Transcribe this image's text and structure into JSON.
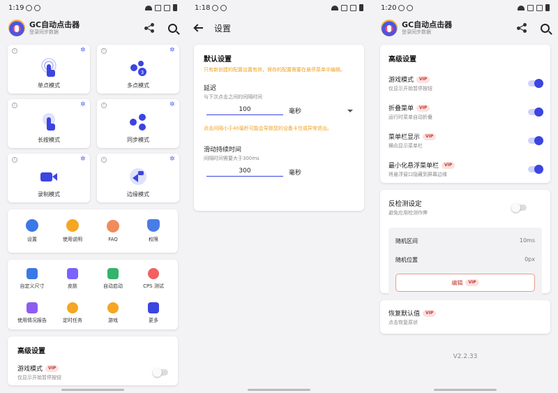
{
  "screen1": {
    "status": {
      "time": "1:19"
    },
    "app": {
      "title": "GC自动点击器",
      "subtitle": "登录同步数据"
    },
    "modes": [
      {
        "label": "单点模式",
        "icon": "single-tap-icon"
      },
      {
        "label": "多点模式",
        "icon": "multi-tap-icon"
      },
      {
        "label": "长按模式",
        "icon": "long-press-icon"
      },
      {
        "label": "同步模式",
        "icon": "sync-icon"
      },
      {
        "label": "录制模式",
        "icon": "record-icon"
      },
      {
        "label": "边缘模式",
        "icon": "edge-icon"
      }
    ],
    "quick": [
      {
        "label": "设置",
        "icon": "gear-icon",
        "color": "#3b78e7"
      },
      {
        "label": "使用说明",
        "icon": "info-icon",
        "color": "#f5a623"
      },
      {
        "label": "FAQ",
        "icon": "question-icon",
        "color": "#f28b5b"
      },
      {
        "label": "权限",
        "icon": "shield-icon",
        "color": "#4a7ce6"
      }
    ],
    "tools": [
      {
        "label": "自定义尺寸",
        "icon": "ruler-icon",
        "color": "#3b78e7"
      },
      {
        "label": "皮肤",
        "icon": "shirt-icon",
        "color": "#7b61ff"
      },
      {
        "label": "自动启动",
        "icon": "phone-icon",
        "color": "#34b36b"
      },
      {
        "label": "CPS 测试",
        "icon": "speedometer-icon",
        "color": "#f26060"
      },
      {
        "label": "使用情况报告",
        "icon": "chart-icon",
        "color": "#8e5cf0"
      },
      {
        "label": "定时任务",
        "icon": "timer-icon",
        "color": "#f5a623"
      },
      {
        "label": "游戏",
        "icon": "game-icon",
        "color": "#f5a623"
      },
      {
        "label": "更多",
        "icon": "grid-icon",
        "color": "#3b45e0"
      }
    ],
    "advanced": {
      "header": "高级设置",
      "game_mode": "游戏模式",
      "vip": "VIP",
      "game_mode_sub": "仅显示开始暂停按钮"
    }
  },
  "screen2": {
    "status": {
      "time": "1:18"
    },
    "title": "设置",
    "default_header": "默认设置",
    "default_note": "只有新创建的配置设置有效，保存的配置需要在悬停菜单中编辑。",
    "delay_label": "延迟",
    "delay_sub": "与下次点击之间的间隔时间",
    "delay_value": "100",
    "delay_unit": "毫秒",
    "delay_warning": "点击间隔小于40毫秒可能会导致您的设备卡住或异常退出。",
    "swipe_label": "滑动持续时间",
    "swipe_sub": "间隔时间需要大于300ms",
    "swipe_value": "300",
    "swipe_unit": "毫秒"
  },
  "screen3": {
    "status": {
      "time": "1:20"
    },
    "app": {
      "title": "GC自动点击器",
      "subtitle": "登录同步数据"
    },
    "advanced_header": "高级设置",
    "vip": "VIP",
    "settings": [
      {
        "title": "游戏模式",
        "sub": "仅显示开始暂停按钮",
        "on": true
      },
      {
        "title": "折叠菜单",
        "sub": "运行时菜单自动折叠",
        "on": true
      },
      {
        "title": "菜单栏显示",
        "sub": "横向显示菜单栏",
        "on": true
      },
      {
        "title": "最小化悬浮菜单栏",
        "sub": "将悬浮窗口隐藏到屏幕边缘",
        "on": true
      }
    ],
    "anti": {
      "title": "反检测设定",
      "sub": "避免应用检测作弊",
      "on": false,
      "random_interval_label": "随机区间",
      "random_interval_value": "10ms",
      "random_position_label": "随机位置",
      "random_position_value": "0px",
      "edit_label": "编辑"
    },
    "restore": {
      "title": "恢复默认值",
      "sub": "点击恢复原状"
    },
    "version": "V2.2.33"
  },
  "colors": {
    "accent": "#3b45e0",
    "warning": "#f0a020",
    "vip_text": "#c0392b",
    "vip_bg": "#fbe0e0"
  }
}
